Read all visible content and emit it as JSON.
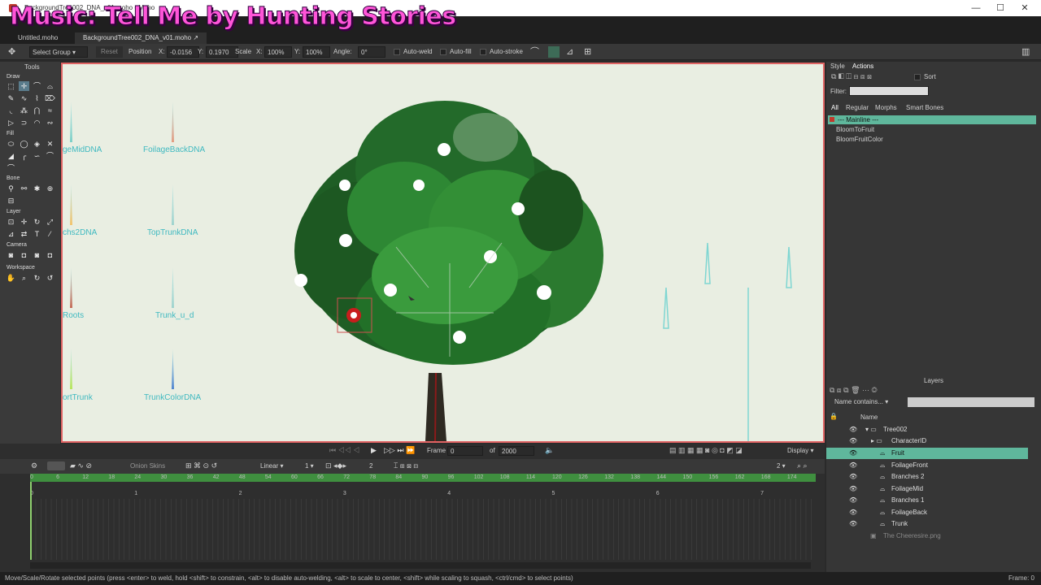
{
  "window": {
    "title": "BackgroundTree002_DNA_v01.moho - Moho",
    "minimize": "—",
    "maximize": "☐",
    "close": "✕"
  },
  "overlay_text": "Music: Tell Me by Hunting Stories",
  "tabs": [
    {
      "label": "Untitled.moho"
    },
    {
      "label": "BackgroundTree002_DNA_v01.moho ↗"
    }
  ],
  "tool_options": {
    "select_group": "Select Group",
    "reset": "Reset",
    "position_label": "Position",
    "x_label": "X:",
    "x_value": "-0.0156",
    "y_label": "Y:",
    "y_value": "0.1970",
    "scale_label": "Scale",
    "sx_label": "X:",
    "sx_value": "100%",
    "sy_label": "Y:",
    "sy_value": "100%",
    "angle_label": "Angle:",
    "angle_value": "0°",
    "auto_weld": "Auto-weld",
    "auto_fill": "Auto-fill",
    "auto_stroke": "Auto-stroke"
  },
  "tools_panel": {
    "title": "Tools",
    "draw": "Draw",
    "fill": "Fill",
    "bone": "Bone",
    "layer": "Layer",
    "camera": "Camera",
    "workspace": "Workspace"
  },
  "canvas_labels": {
    "col1": [
      "geMidDNA",
      "chs2DNA",
      "Roots",
      "ortTrunk"
    ],
    "col2": [
      "FoilageBackDNA",
      "TopTrunkDNA",
      "Trunk_u_d",
      "TrunkColorDNA"
    ]
  },
  "style_panel": {
    "tab_style": "Style",
    "tab_actions": "Actions",
    "sort": "Sort",
    "filter_label": "Filter:",
    "subtabs": [
      "All",
      "Regular",
      "Morphs",
      "Smart Bones"
    ],
    "actions": [
      "--- Mainline ---",
      "BloomToFruit",
      "BloomFruitColor"
    ]
  },
  "layers_panel": {
    "title": "Layers",
    "filter_mode": "Name contains...",
    "name_header": "Name",
    "layers": [
      {
        "name": "Tree002"
      },
      {
        "name": "CharacterID"
      },
      {
        "name": "Fruit"
      },
      {
        "name": "FoilageFront"
      },
      {
        "name": "Branches 2"
      },
      {
        "name": "FoilageMid"
      },
      {
        "name": "Branches 1"
      },
      {
        "name": "FoilageBack"
      },
      {
        "name": "Trunk"
      },
      {
        "name": "The Cheeresire.png"
      }
    ]
  },
  "playback": {
    "frame_label": "Frame",
    "frame_value": "0",
    "of_label": "of",
    "total": "2000",
    "display": "Display"
  },
  "timeline": {
    "onion_skins": "Onion Skins",
    "interp": "Linear",
    "one": "1",
    "two": "2",
    "ruler": [
      "0",
      "6",
      "12",
      "18",
      "24",
      "30",
      "36",
      "42",
      "48",
      "54",
      "60",
      "66",
      "72",
      "78",
      "84",
      "90",
      "96",
      "102",
      "108",
      "114",
      "120",
      "126",
      "132",
      "138",
      "144",
      "150",
      "156",
      "162",
      "168",
      "174"
    ],
    "seconds": [
      "0",
      "1",
      "2",
      "3",
      "4",
      "5",
      "6",
      "7"
    ]
  },
  "status": {
    "text": "Move/Scale/Rotate selected points (press <enter> to weld, hold <shift> to constrain, <alt> to disable auto-welding, <alt> to scale to center, <shift> while scaling to squash, <ctrl/cmd> to select points)",
    "frame": "Frame: 0"
  },
  "colors": {
    "accent": "#5fb79c",
    "canvas_border": "#e06464",
    "overlay": "#ff55d8",
    "dna_text": "#3fb9c0"
  }
}
